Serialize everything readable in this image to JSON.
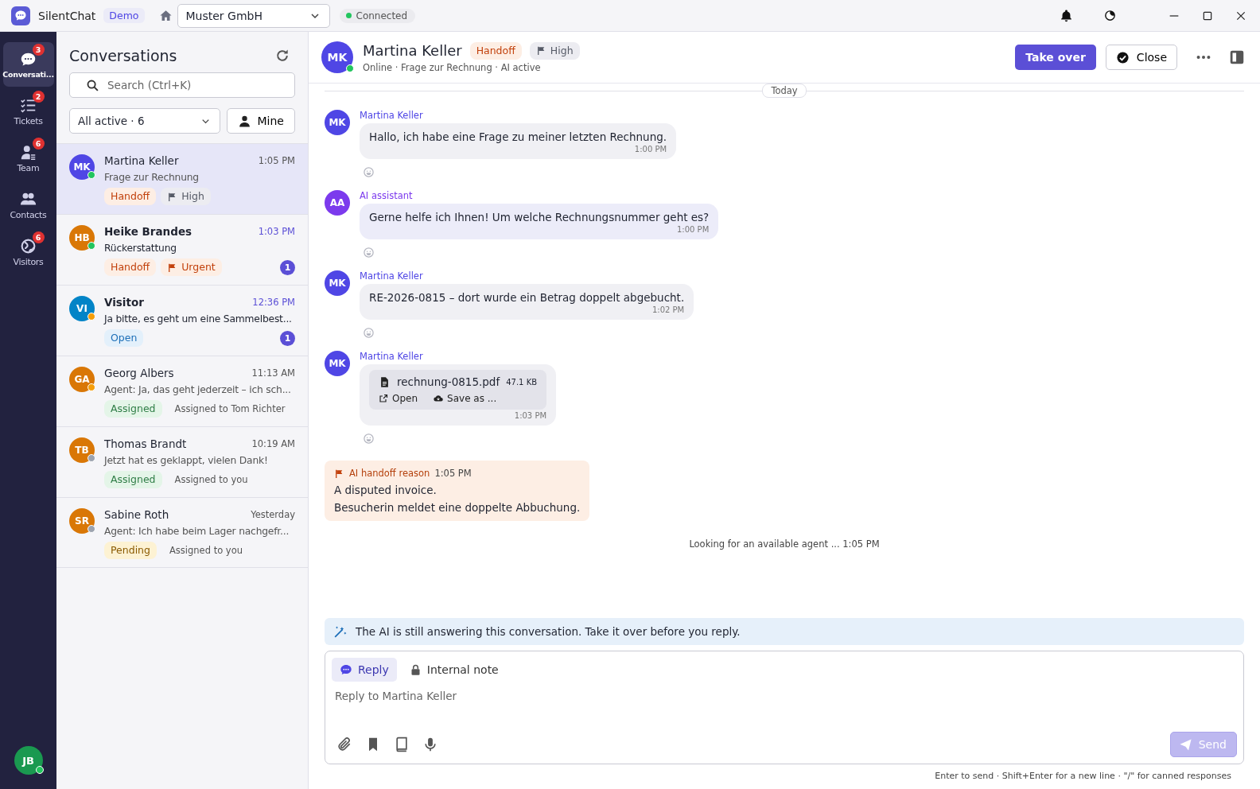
{
  "titlebar": {
    "app_name": "SilentChat",
    "badge": "Demo",
    "workspace": "Muster GmbH",
    "connection": "Connected"
  },
  "nav": {
    "items": [
      {
        "label": "Conversati...",
        "badge": "3",
        "selected": true
      },
      {
        "label": "Tickets",
        "badge": "2",
        "selected": false
      },
      {
        "label": "Team",
        "badge": "6",
        "selected": false
      },
      {
        "label": "Contacts",
        "selected": false
      },
      {
        "label": "Visitors",
        "badge": "6",
        "selected": false
      }
    ],
    "user": {
      "avatar": {
        "initials": "JB",
        "color": "#1a9950"
      },
      "presence": {
        "color": "#22c55e"
      }
    }
  },
  "conversations": {
    "title": "Conversations",
    "search": {
      "placeholder": "Search (Ctrl+K)"
    },
    "filter": "All active · 6",
    "mine_button": "Mine",
    "items": [
      {
        "avatar": {
          "initials": "MK",
          "color": "#4f46e5"
        },
        "presence": {
          "color": "#22c55e"
        },
        "name": "Martina Keller",
        "time": "1:05 PM",
        "preview": "Frage zur Rechnung",
        "tags": [
          {
            "label": "Handoff",
            "kind": "handoff"
          },
          {
            "label": "High",
            "kind": "high"
          }
        ],
        "selected": true
      },
      {
        "avatar": {
          "initials": "HB",
          "color": "#d97706"
        },
        "presence": {
          "color": "#22c55e"
        },
        "name": "Heike Brandes",
        "time": "1:03 PM",
        "preview": "Rückerstattung",
        "tags": [
          {
            "label": "Handoff",
            "kind": "handoff"
          },
          {
            "label": "Urgent",
            "kind": "urgent"
          }
        ],
        "unread": "1",
        "selected": false
      },
      {
        "avatar": {
          "initials": "VI",
          "color": "#0284c7"
        },
        "presence": {
          "color": "#f59e0b"
        },
        "name": "Visitor",
        "time": "12:36 PM",
        "preview": "Ja bitte, es geht um eine Sammelbest...",
        "tags": [
          {
            "label": "Open",
            "kind": "open"
          }
        ],
        "unread": "1",
        "selected": false
      },
      {
        "avatar": {
          "initials": "GA",
          "color": "#d97706"
        },
        "presence": {
          "color": "#f59e0b"
        },
        "name": "Georg Albers",
        "time": "11:13 AM",
        "preview": "Agent: Ja, das geht jederzeit – ich sch...",
        "tags": [
          {
            "label": "Assigned",
            "kind": "assigned"
          }
        ],
        "assignee": "Assigned to Tom Richter",
        "selected": false
      },
      {
        "avatar": {
          "initials": "TB",
          "color": "#d97706"
        },
        "presence": {
          "color": "#9ca3af"
        },
        "name": "Thomas Brandt",
        "time": "10:19 AM",
        "preview": "Jetzt hat es geklappt, vielen Dank!",
        "tags": [
          {
            "label": "Assigned",
            "kind": "assigned"
          }
        ],
        "assignee": "Assigned to you",
        "selected": false
      },
      {
        "avatar": {
          "initials": "SR",
          "color": "#d97706"
        },
        "presence": {
          "color": "#9ca3af"
        },
        "name": "Sabine Roth",
        "time": "Yesterday",
        "preview": "Agent: Ich habe beim Lager nachgefr...",
        "tags": [
          {
            "label": "Pending",
            "kind": "pending"
          }
        ],
        "assignee": "Assigned to you",
        "selected": false
      }
    ]
  },
  "chat": {
    "header": {
      "avatar": {
        "initials": "MK",
        "color": "#4f46e5"
      },
      "presence": {
        "color": "#22c55e"
      },
      "name": "Martina Keller",
      "tags": [
        {
          "label": "Handoff",
          "kind": "handoff"
        },
        {
          "label": "High",
          "kind": "high"
        }
      ],
      "subtitle": "Online · Frage zur Rechnung · AI active",
      "take_over": "Take over",
      "close": "Close"
    },
    "date_divider": "Today",
    "messages": [
      {
        "kind": "visitor",
        "initials": "MK",
        "author": "Martina Keller",
        "text": "Hallo, ich habe eine Frage zu meiner letzten Rechnung.",
        "time": "1:00 PM"
      },
      {
        "kind": "ai",
        "initials": "AA",
        "author": "AI assistant",
        "text": "Gerne helfe ich Ihnen! Um welche Rechnungsnummer geht es?",
        "time": "1:00 PM"
      },
      {
        "kind": "visitor",
        "initials": "MK",
        "author": "Martina Keller",
        "text": "RE-2026-0815 – dort wurde ein Betrag doppelt abgebucht.",
        "time": "1:02 PM"
      },
      {
        "kind": "file",
        "initials": "MK",
        "author": "Martina Keller",
        "file_name": "rechnung-0815.pdf",
        "file_size": "47.1 KB",
        "actions": [
          "Open",
          "Save as ..."
        ],
        "time": "1:03 PM"
      },
      {
        "kind": "handoff",
        "title": "AI handoff reason",
        "time": "1:05 PM",
        "lines": [
          "A disputed invoice.",
          "Besucherin meldet eine doppelte Abbuchung."
        ]
      },
      {
        "kind": "system",
        "text": "Looking for an available agent ... 1:05 PM"
      }
    ],
    "ai_banner": "The AI is still answering this conversation. Take it over before you reply.",
    "composer": {
      "tabs": [
        {
          "label": "Reply",
          "selected": true
        },
        {
          "label": "Internal note",
          "selected": false
        }
      ],
      "placeholder": "Reply to Martina Keller",
      "send": "Send",
      "send_disabled": true,
      "hint": "Enter to send · Shift+Enter for a new line · \"/\" for canned responses"
    }
  }
}
